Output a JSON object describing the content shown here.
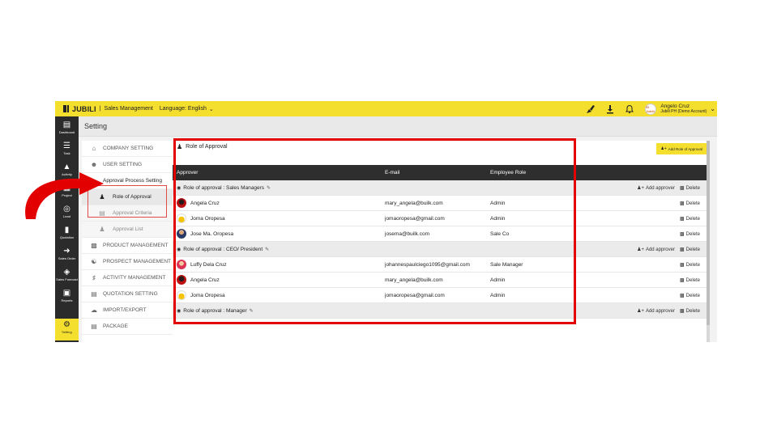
{
  "topbar": {
    "brand": "JUBILI",
    "separator": "|",
    "module": "Sales Management",
    "language": "Language: English",
    "company_badge": "El Jubili",
    "user_name": "Angelo Cruz",
    "user_account": "Jubili PH (Demo Account)"
  },
  "leftnav": {
    "items": [
      {
        "label": "Dashboard",
        "icon": "dashboard-icon"
      },
      {
        "label": "Task",
        "icon": "task-icon"
      },
      {
        "label": "Activity",
        "icon": "activity-icon"
      },
      {
        "label": "Project",
        "icon": "project-icon"
      },
      {
        "label": "Lead",
        "icon": "lead-icon"
      },
      {
        "label": "Quotation",
        "icon": "quotation-icon"
      },
      {
        "label": "Sales Order",
        "icon": "sales-order-icon"
      },
      {
        "label": "Sales Forecast",
        "icon": "sales-forecast-icon"
      },
      {
        "label": "Reports",
        "icon": "reports-icon"
      },
      {
        "label": "Setting",
        "icon": "gears-icon"
      }
    ]
  },
  "page": {
    "title": "Setting"
  },
  "settings_menu": {
    "company": "COMPANY SETTING",
    "user": "USER SETTING",
    "approval": "Approval Process Setting",
    "sub_role": "Role of Approval",
    "sub_criteria": "Approval Criteria",
    "sub_list": "Approval List",
    "product": "PRODUCT MANAGEMENT",
    "prospect": "PROSPECT MANAGEMENT",
    "activity": "ACTIVITY MANAGEMENT",
    "quotation": "QUOTATION SETTING",
    "import": "IMPORT/EXPORT",
    "package": "PACKAGE"
  },
  "panel": {
    "title": "Role of Approval",
    "add_role_button": "Add Role of Approval",
    "columns": {
      "approver": "Approver",
      "email": "E-mail",
      "role": "Employee Role"
    },
    "add_approver": "Add approver",
    "delete": "Delete",
    "groups": [
      {
        "name": "Role of approval : Sales Managers",
        "members": [
          {
            "name": "Angela Cruz",
            "email": "mary_angela@builk.com",
            "role": "Admin"
          },
          {
            "name": "Joma Oropesa",
            "email": "jomaoropesa@gmail.com",
            "role": "Admin"
          },
          {
            "name": "Jose Ma. Oropesa",
            "email": "josema@builk.com",
            "role": "Sale Co"
          }
        ]
      },
      {
        "name": "Role of approval : CEO/ President",
        "members": [
          {
            "name": "Luffy Dela Cruz",
            "email": "johannespaulciego1095@gmail.com",
            "role": "Sale Manager"
          },
          {
            "name": "Angela Cruz",
            "email": "mary_angela@builk.com",
            "role": "Admin"
          },
          {
            "name": "Joma Oropesa",
            "email": "jomaoropesa@gmail.com",
            "role": "Admin"
          }
        ]
      },
      {
        "name": "Role of approval : Manager",
        "members": []
      }
    ]
  },
  "colors": {
    "brand_yellow": "#f5df2e",
    "nav_dark": "#2b2b2b",
    "annotation_red": "#e20000"
  }
}
